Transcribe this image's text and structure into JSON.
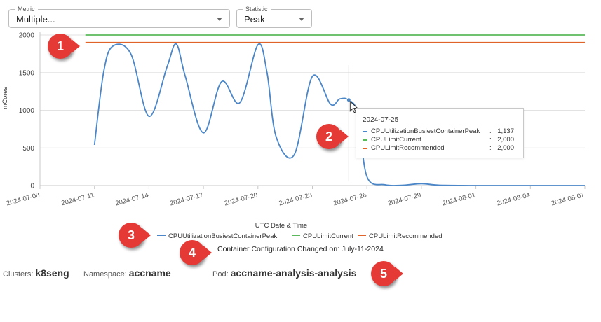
{
  "filters": {
    "metric": {
      "label": "Metric",
      "value": "Multiple..."
    },
    "statistic": {
      "label": "Statistic",
      "value": "Peak"
    }
  },
  "chart_data": {
    "type": "line",
    "title": "",
    "xlabel": "UTC Date & Time",
    "ylabel": "mCores",
    "ylim": [
      0,
      2000
    ],
    "xlim": [
      "2024-07-08",
      "2024-08-07"
    ],
    "yticks": [
      "0",
      "500",
      "1000",
      "1500",
      "2000"
    ],
    "xticks": [
      "2024-07-08",
      "2024-07-11",
      "2024-07-14",
      "2024-07-17",
      "2024-07-20",
      "2024-07-23",
      "2024-07-26",
      "2024-07-29",
      "2024-08-01",
      "2024-08-04",
      "2024-08-07"
    ],
    "grid": true,
    "legend_position": "bottom",
    "series": [
      {
        "name": "CPUUtilizationBusiestContainerPeak",
        "color": "#4a86c8",
        "points": [
          [
            "2024-07-11",
            540
          ],
          [
            "2024-07-11.5",
            1500
          ],
          [
            "2024-07-12",
            1850
          ],
          [
            "2024-07-13",
            1750
          ],
          [
            "2024-07-14",
            920
          ],
          [
            "2024-07-15",
            1580
          ],
          [
            "2024-07-15.5",
            1880
          ],
          [
            "2024-07-16",
            1450
          ],
          [
            "2024-07-17",
            700
          ],
          [
            "2024-07-18",
            1380
          ],
          [
            "2024-07-19",
            1100
          ],
          [
            "2024-07-20",
            1870
          ],
          [
            "2024-07-20.5",
            1500
          ],
          [
            "2024-07-21",
            650
          ],
          [
            "2024-07-22",
            410
          ],
          [
            "2024-07-23",
            1450
          ],
          [
            "2024-07-24",
            1080
          ],
          [
            "2024-07-24.5",
            1150
          ],
          [
            "2024-07-25",
            1137
          ],
          [
            "2024-07-25.5",
            950
          ],
          [
            "2024-07-26",
            120
          ],
          [
            "2024-07-27",
            10
          ],
          [
            "2024-07-28",
            5
          ],
          [
            "2024-07-29",
            25
          ],
          [
            "2024-07-30",
            5
          ],
          [
            "2024-08-01",
            0
          ],
          [
            "2024-08-04",
            0
          ],
          [
            "2024-08-07",
            0
          ]
        ]
      },
      {
        "name": "CPULimitCurrent",
        "color": "#5cb85c",
        "points": [
          [
            "2024-07-10.5",
            2000
          ],
          [
            "2024-08-07",
            2000
          ]
        ]
      },
      {
        "name": "CPULimitRecommended",
        "color": "#e0642a",
        "points": [
          [
            "2024-07-10.5",
            1900
          ],
          [
            "2024-08-07",
            1900
          ]
        ]
      }
    ],
    "hover_date": "2024-07-25"
  },
  "tooltip": {
    "date": "2024-07-25",
    "rows": [
      {
        "name": "CPUUtilizationBusiestContainerPeak",
        "value": "1,137",
        "color": "#4a86c8"
      },
      {
        "name": "CPULimitCurrent",
        "value": "2,000",
        "color": "#5cb85c"
      },
      {
        "name": "CPULimitRecommended",
        "value": "2,000",
        "color": "#e0642a"
      }
    ]
  },
  "config_note": "Container Configuration Changed on: July-11-2024",
  "info": {
    "clusters_label": "Clusters:",
    "clusters_value": "k8seng",
    "namespace_label": "Namespace:",
    "namespace_value": "accname",
    "pod_label": "Pod:",
    "pod_value": "accname-analysis-analysis"
  },
  "badges": [
    "1",
    "2",
    "3",
    "4",
    "5"
  ],
  "badge_color": "#e53935"
}
